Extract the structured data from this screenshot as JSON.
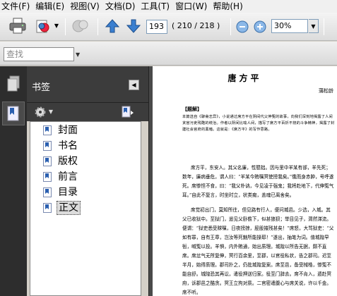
{
  "menu": {
    "items": [
      "文件(F)",
      "编辑(E)",
      "视图(V)",
      "文档(D)",
      "工具(T)",
      "窗口(W)",
      "帮助(H)"
    ]
  },
  "toolbar": {
    "current_page": "193",
    "page_count": "( 210 / 218 )",
    "zoom": "30%"
  },
  "find": {
    "placeholder": "查找"
  },
  "bookmarks": {
    "title": "书签",
    "items": [
      {
        "label": "封面"
      },
      {
        "label": "书名"
      },
      {
        "label": "版权"
      },
      {
        "label": "前言"
      },
      {
        "label": "目录"
      },
      {
        "label": "正文",
        "selected": true
      }
    ]
  },
  "document": {
    "title": "唐方平",
    "author": "蒲松龄",
    "section_tag": "【题解】",
    "intro": "本篇选自《聊斋志异》，小说通过席方平在阴间代父伸冤的故事，向我们深刻地揭露了人间贪官污吏残酷的统治。作者以阴间比喻人间，描写了席方平百折不挠的斗争精神，揭露了封建社会官府的黑暗。这就是：《席方平》的写作思路。",
    "para1": "席方平，东安人。其父名廉，性戆拙。因与里中羊某有郤，羊先死；数年，廉病垂危，谓人曰：“羊某今贿嘱冥使搒我矣。”俄而身赤肿，号呼遂死。席惨怛不食，曰：“我父朴讷，今见凌于强鬼；我将赴地下，代伸冤气耳。”自此不复言，时坐时立，状类痴，盖魂已离舍矣。",
    "para2": "席觉初出门，莫知所往，但见路有行人，便问城邑。少选，入城。其父已收狱中。至狱门，遥见父卧檐下，似甚狼狈；举目见子，潸然涕流。便谓：“狱吏悉受赇嘱，日夜搒掠，胫股摧残甚矣！”席怒，大骂狱吏：“父如有罪，自有王章，岂汝等死魅所能操耶！”遂出，抽笔为词。值城隍早衙，喊冤以投。羊惧，内外贿通，始出质理。城隍以所告无据，颇不直席。席忿气无所复伸，冥行百余里，至郡，以官役私状，告之郡司。迟至半月，始得质理。郡司扑之，仍批城隍复案。席至邑，备受械梏，惨冤不能自舒。城隍恐其再讼，遣役押送归家。役至门辞去。席不肯入，遁赴冥府，诉郡邑之酷贪。冥王立拘对质。二官密遣腹心与席关说，许以千金。席不听。"
  }
}
